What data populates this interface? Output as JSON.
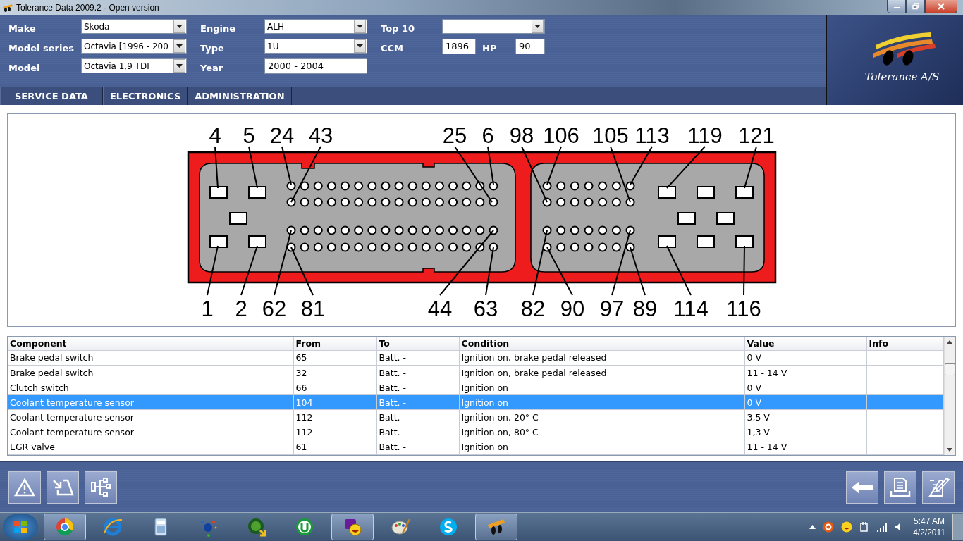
{
  "window": {
    "title": "Tolerance Data 2009.2 - Open version"
  },
  "vehicle_form": {
    "columns": [
      [
        {
          "label": "Make",
          "kind": "dropdown",
          "value": "Skoda"
        },
        {
          "label": "Model series",
          "kind": "dropdown",
          "value": "Octavia [1996 - 200"
        },
        {
          "label": "Model",
          "kind": "dropdown",
          "value": "Octavia 1,9 TDI"
        }
      ],
      [
        {
          "label": "Engine",
          "kind": "dropdown",
          "value": "ALH"
        },
        {
          "label": "Type",
          "kind": "dropdown",
          "value": "1U"
        },
        {
          "label": "Year",
          "kind": "text",
          "value": "2000 - 2004"
        }
      ],
      [
        {
          "label": "Top 10",
          "kind": "dropdown"
        },
        {
          "kind": "pair",
          "fields": [
            {
              "label": "CCM",
              "value": "1896"
            },
            {
              "label": "HP",
              "value": "90"
            }
          ]
        }
      ]
    ]
  },
  "logo": {
    "text": "Tolerance A/S"
  },
  "tabs": [
    {
      "label": "SERVICE DATA",
      "selected": false
    },
    {
      "label": "ELECTRONICS",
      "selected": false
    },
    {
      "label": "ADMINISTRATION",
      "selected": false
    }
  ],
  "connector": {
    "top_pins": [
      "4",
      "5",
      "24",
      "43",
      "25",
      "6",
      "98",
      "106",
      "105",
      "113",
      "119",
      "121"
    ],
    "bottom_pins": [
      "1",
      "2",
      "62",
      "81",
      "44",
      "63",
      "82",
      "90",
      "97",
      "89",
      "114",
      "116"
    ]
  },
  "table": {
    "columns": [
      "Component",
      "From",
      "To",
      "Condition",
      "Value",
      "Info"
    ],
    "rows": [
      {
        "cells": [
          "Brake pedal switch",
          "65",
          "Batt. -",
          "Ignition on, brake pedal released",
          "0 V"
        ],
        "selected": false
      },
      {
        "cells": [
          "Brake pedal switch",
          "32",
          "Batt. -",
          "Ignition on, brake pedal released",
          "11 - 14 V"
        ],
        "selected": false
      },
      {
        "cells": [
          "Clutch switch",
          "66",
          "Batt. -",
          "Ignition on",
          "0 V"
        ],
        "selected": false
      },
      {
        "cells": [
          "Coolant temperature sensor",
          "104",
          "Batt. -",
          "Ignition on",
          "0 V"
        ],
        "selected": true
      },
      {
        "cells": [
          "Coolant temperature sensor",
          "112",
          "Batt. -",
          "Ignition on, 20° C",
          "3,5 V"
        ],
        "selected": false
      },
      {
        "cells": [
          "Coolant temperature sensor",
          "112",
          "Batt. -",
          "Ignition on, 80° C",
          "1,3 V"
        ],
        "selected": false
      },
      {
        "cells": [
          "EGR valve",
          "61",
          "Batt. -",
          "Ignition on",
          "11 - 14 V"
        ],
        "selected": false
      }
    ]
  },
  "taskbar": {
    "apps": [
      {
        "running": true
      },
      {
        "running": false
      },
      {
        "running": false
      },
      {
        "running": false
      },
      {
        "running": false
      },
      {
        "running": false
      },
      {
        "running": true
      },
      {
        "running": false
      },
      {
        "running": false
      },
      {
        "running": true
      }
    ],
    "time": "5:47 AM",
    "date": "4/2/2011"
  }
}
